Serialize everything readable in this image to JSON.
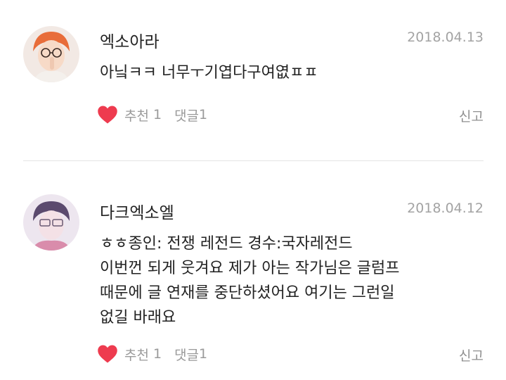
{
  "comments": [
    {
      "username": "엑소아라",
      "date": "2018.04.13",
      "lines": [
        "아닠ㅋㅋ 너무ㅜ기엽다구여엾ㅍㅍ"
      ],
      "like_label": "추천",
      "like_count": "1",
      "reply_label": "댓글",
      "reply_count": "1",
      "report_label": "신고"
    },
    {
      "username": "다크엑소엘",
      "date": "2018.04.12",
      "lines": [
        "ㅎㅎ종인: 전쟁 레전드 경수:국자레전드",
        "이번껀 되게 웃겨요 제가 아는 작가님은 글럼프",
        "때문에 글 연재를 중단하셨어요 여기는 그런일",
        "없길 바래요"
      ],
      "like_label": "추천",
      "like_count": "1",
      "reply_label": "댓글",
      "reply_count": "1",
      "report_label": "신고"
    }
  ],
  "icons": {
    "like": "heart-icon"
  },
  "colors": {
    "heart": "#ee3b4f",
    "muted": "#9a9a9a",
    "date": "#a3a3a3",
    "divider": "#e4e4e4"
  }
}
